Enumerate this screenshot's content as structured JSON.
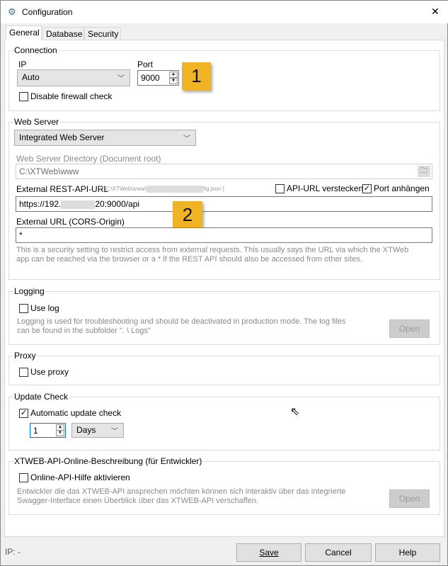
{
  "window": {
    "title": "Configuration",
    "icon": "gear-globe-icon",
    "close": "✕"
  },
  "tabs": [
    {
      "label": "General",
      "selected": true
    },
    {
      "label": "Database"
    },
    {
      "label": "Security"
    }
  ],
  "connection": {
    "title": "Connection",
    "ip_label": "IP",
    "ip_value": "Auto",
    "port_label": "Port",
    "port_value": "9000",
    "disable_firewall_label": "Disable firewall check",
    "disable_firewall_checked": false,
    "badge": "1"
  },
  "web_server": {
    "title": "Web Server",
    "server_type": "Integrated Web Server",
    "dir_label": "Web Server Directory (Document root)",
    "dir_value": "C:\\XTWeb\\www",
    "rest_label": "External REST-API-URL",
    "rest_path_hint_prefix": "[ C:\\XTWeb\\www\\",
    "rest_path_hint_suffix": "fig.json ]",
    "hide_api_label": "API-URL verstecken",
    "hide_api_checked": false,
    "append_port_label": "Port anhängen",
    "append_port_checked": true,
    "rest_value_prefix": "https://192.",
    "rest_value_suffix": "20:9000/api",
    "cors_label": "External URL (CORS-Origin)",
    "cors_value": "*",
    "help_line1": "This is a security setting to restrict access from external requests. This usually says the URL via which the XTWeb",
    "help_line2": "app can be reached via the browser or a * if the REST API should also be accessed from other sites.",
    "badge": "2"
  },
  "logging": {
    "title": "Logging",
    "use_log_label": "Use log",
    "checked": false,
    "help_line1": "Logging is used for troubleshooting and should be deactivated in production mode. The log files",
    "help_line2": "can be found in the subfolder \". \\ Logs\"",
    "open_label": "Open"
  },
  "proxy": {
    "title": "Proxy",
    "use_proxy_label": "Use proxy",
    "checked": false
  },
  "update": {
    "title": "Update Check",
    "auto_label": "Automatic update check",
    "checked": true,
    "interval": "1",
    "unit": "Days"
  },
  "api_help": {
    "title": "XTWEB-API-Online-Beschreibung (für Entwickler)",
    "activate_label": "Online-API-Hilfe aktivieren",
    "checked": false,
    "help_line1": "Entwickler die das XTWEB-API ansprechen möchten können sich interaktiv über das integrierte",
    "help_line2": "Swagger-Interface einen Überblick über das XTWEB-API verschaffen.",
    "open_label": "Open"
  },
  "footer": {
    "status": "IP: -",
    "save_label": "Save",
    "cancel_label": "Cancel",
    "help_label": "Help"
  },
  "colors": {
    "badge": "#f0b323"
  }
}
